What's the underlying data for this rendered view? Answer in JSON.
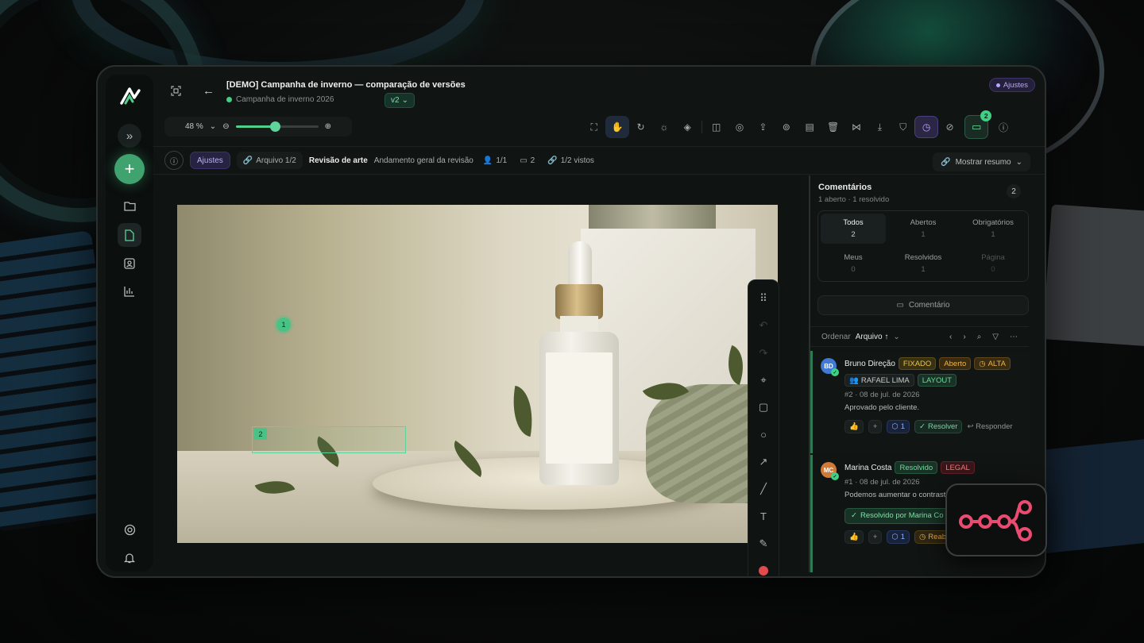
{
  "header": {
    "title": "[DEMO] Campanha de inverno — comparação de versões",
    "campaign": "Campanha de inverno 2026",
    "version": "v2",
    "badge": "Ajustes"
  },
  "zoom": {
    "label": "48 %",
    "level": 0.48
  },
  "subbar": {
    "status_chip": "Ajustes",
    "file": "Arquivo 1/2",
    "review_title": "Revisão de arte",
    "review_desc": "Andamento geral da revisão",
    "reviewers": "1/1",
    "comments": "2",
    "seen": "1/2 vistos",
    "summary_button": "Mostrar resumo"
  },
  "toolbar": {
    "chat_count": "2"
  },
  "annotations": {
    "pin1": "1",
    "pin2": "2"
  },
  "panel": {
    "title": "Comentários",
    "subtitle": "1 aberto · 1 resolvido",
    "count": "2",
    "filters": [
      {
        "label": "Todos",
        "count": "2"
      },
      {
        "label": "Abertos",
        "count": "1"
      },
      {
        "label": "Obrigatórios",
        "count": "1"
      },
      {
        "label": "Meus",
        "count": "0"
      },
      {
        "label": "Resolvidos",
        "count": "1"
      },
      {
        "label": "Página",
        "count": "0"
      }
    ],
    "comment_button": "Comentário",
    "sort_label": "Ordenar",
    "sort_value": "Arquivo ↑"
  },
  "comments": [
    {
      "initials": "BD",
      "author": "Bruno Direção",
      "tags": [
        "FIXADO",
        "Aberto",
        "ALTA"
      ],
      "assignee": "RAFAEL LIMA",
      "category": "LAYOUT",
      "meta": "#2 · 08 de jul. de 2026",
      "text": "Aprovado pelo cliente.",
      "tag_count": "1",
      "resolve": "Resolver",
      "reply": "Responder",
      "avatar_color": "#3f7bd4"
    },
    {
      "initials": "MC",
      "author": "Marina Costa",
      "tags": [
        "Resolvido",
        "LEGAL"
      ],
      "meta": "#1 · 08 de jul. de 2026",
      "text": "Podemos aumentar o contraste",
      "resolved_by": "Resolvido por Marina Co",
      "tag_count": "1",
      "reopen": "Reabri",
      "avatar_color": "#d07a3a"
    }
  ],
  "colors": {
    "accent": "#3fcf85",
    "violet": "#b7a8ff",
    "bg": "#101413"
  }
}
